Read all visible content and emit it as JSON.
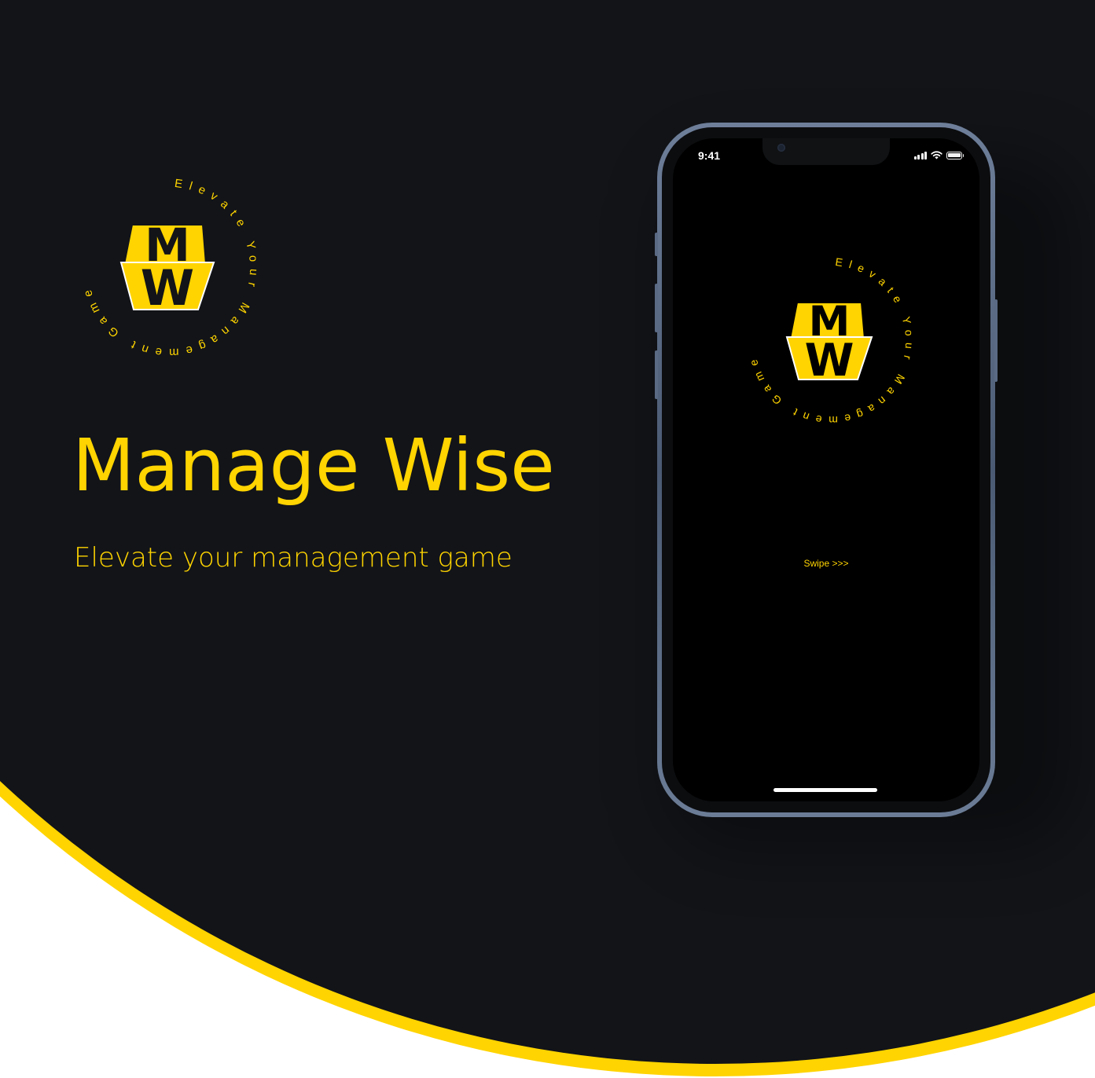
{
  "colors": {
    "accent": "#FFD400",
    "background_dark": "#121418",
    "background_light": "#FFFFFF",
    "phone_frame": "#5A6A84"
  },
  "brand": {
    "monogram_top": "M",
    "monogram_bottom": "W",
    "ring_text": "Elevate Your Management Game"
  },
  "headline": "Manage Wise",
  "tagline": "Elevate your management game",
  "phone": {
    "status_bar": {
      "time": "9:41",
      "icons": [
        "cellular-signal-icon",
        "wifi-icon",
        "battery-icon"
      ]
    },
    "swipe_hint": "Swipe >>>"
  }
}
